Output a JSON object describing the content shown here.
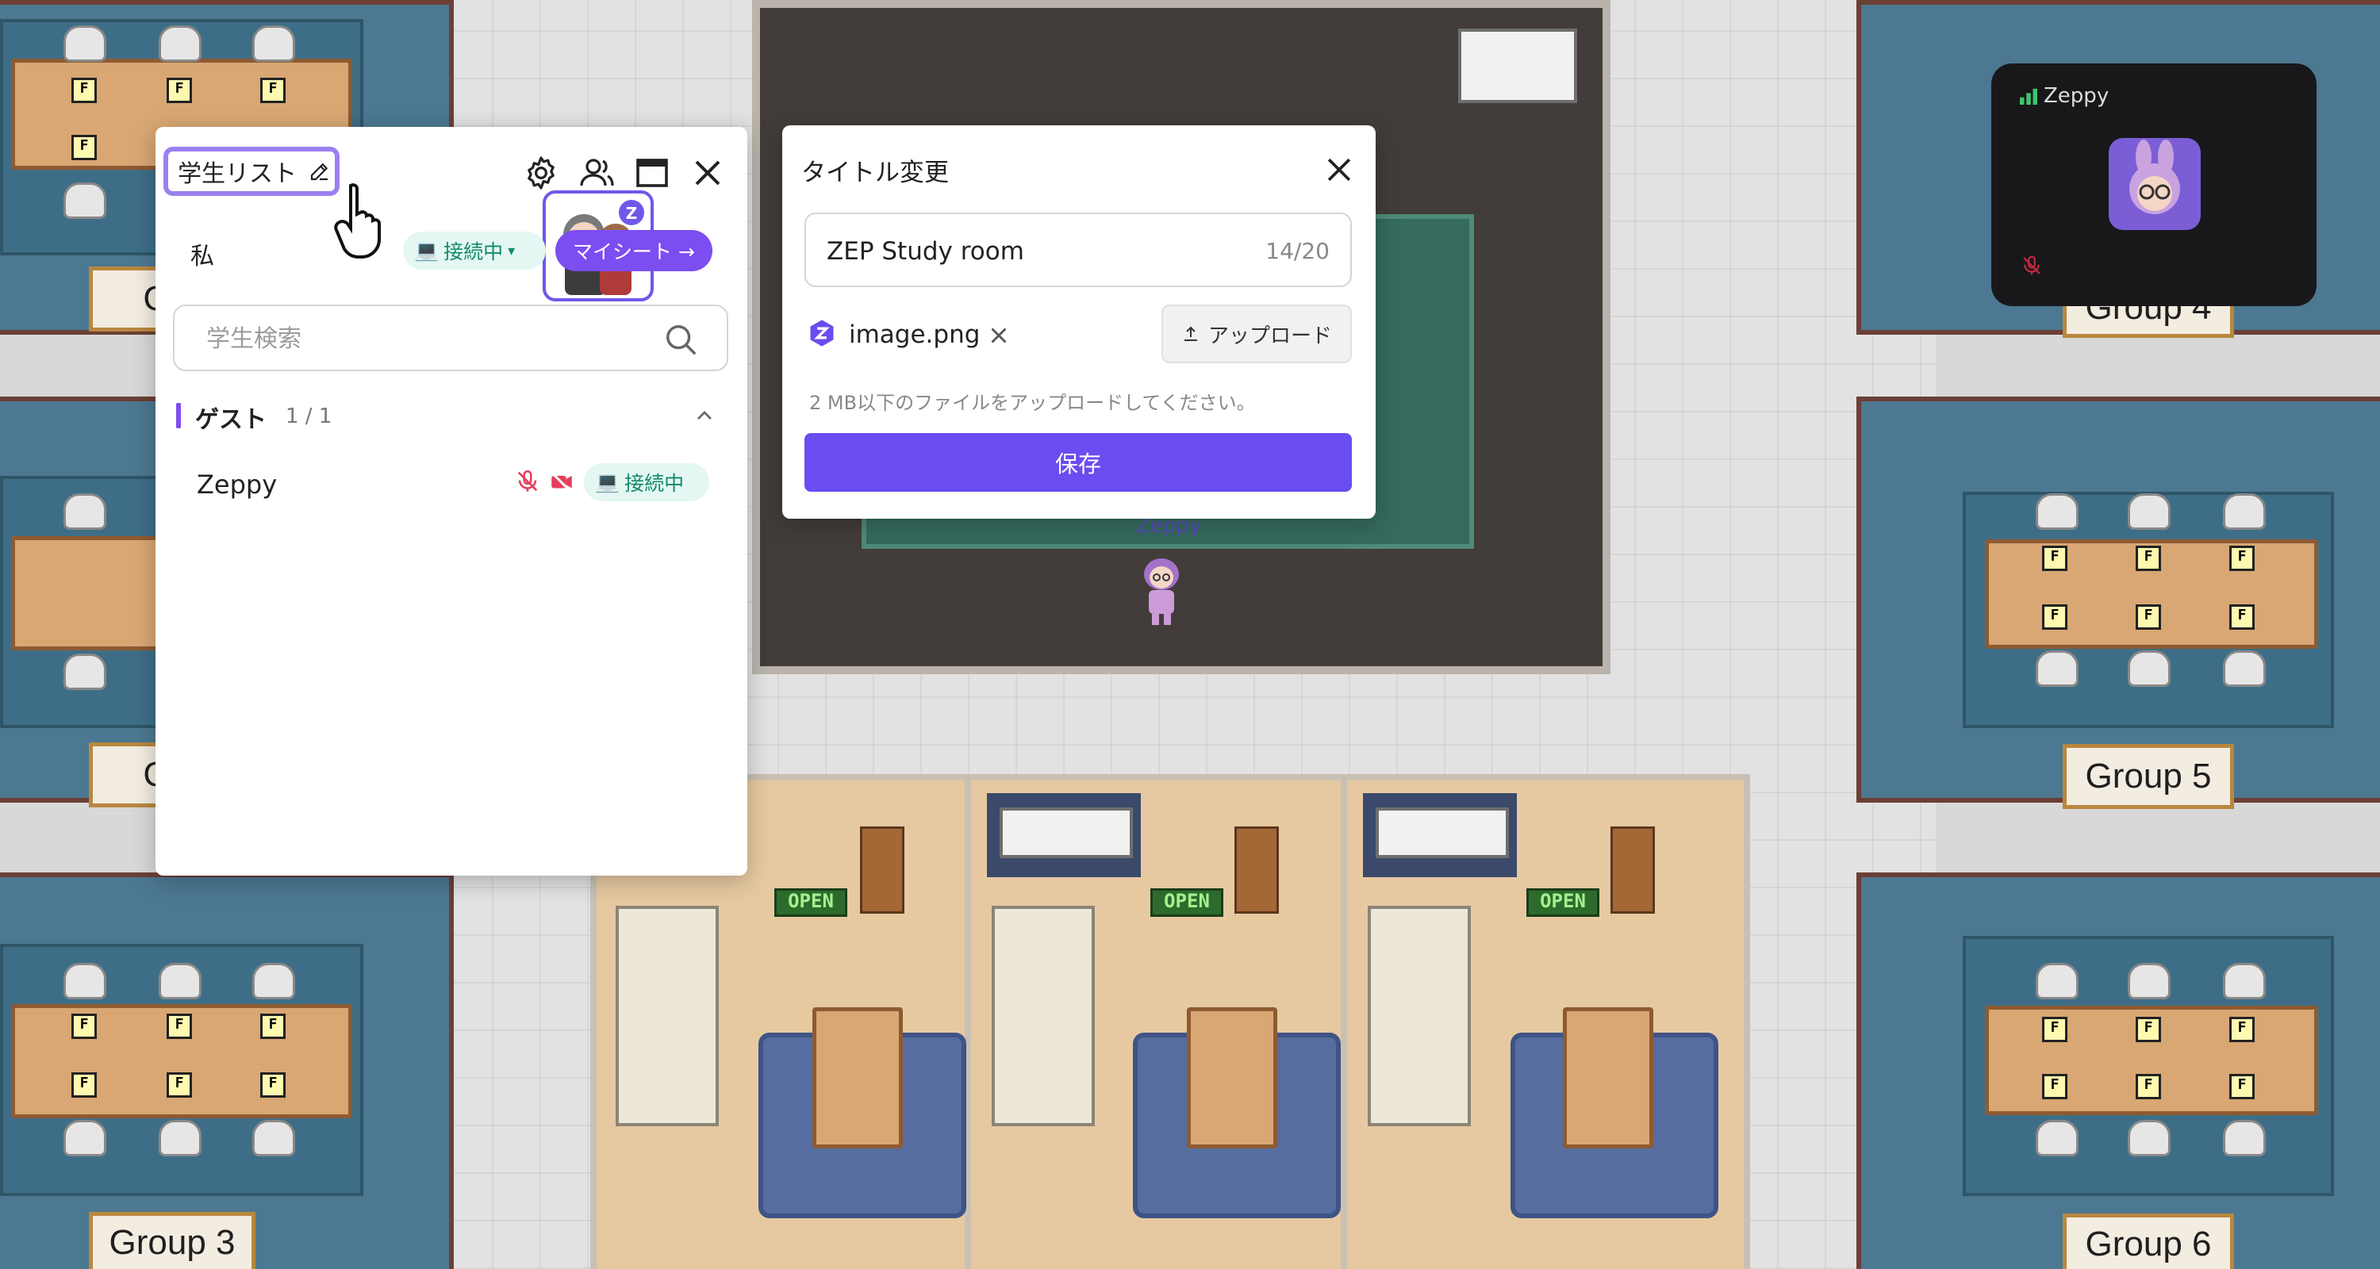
{
  "map": {
    "group_signs": [
      "Gro",
      "Gro",
      "Group 3",
      "Group 4",
      "Group 5",
      "Group 6"
    ],
    "open_signs": [
      "OPEN",
      "OPEN",
      "OPEN"
    ],
    "player_name": "Zeppy",
    "seat_mark": "F"
  },
  "student_panel": {
    "title": "学生リスト",
    "me_label": "私",
    "status_label": "接続中",
    "my_sheet_label": "マイシート →",
    "search_placeholder": "学生検索",
    "section_title": "ゲスト",
    "section_count": "1 / 1",
    "rows": [
      {
        "name": "Zeppy",
        "status": "接続中"
      }
    ]
  },
  "title_dialog": {
    "title": "タイトル変更",
    "input_value": "ZEP Study room",
    "counter": "14/20",
    "file_name": "image.png",
    "upload_label": "アップロード",
    "hint": "2 MB以下のファイルをアップロードしてください。",
    "save_label": "保存"
  },
  "video_tile": {
    "name": "Zeppy"
  },
  "colors": {
    "accent": "#6a4cf0",
    "connected_text": "#138a6b",
    "connected_bg": "#e4f7f2",
    "muted_red": "#e53d5c"
  }
}
